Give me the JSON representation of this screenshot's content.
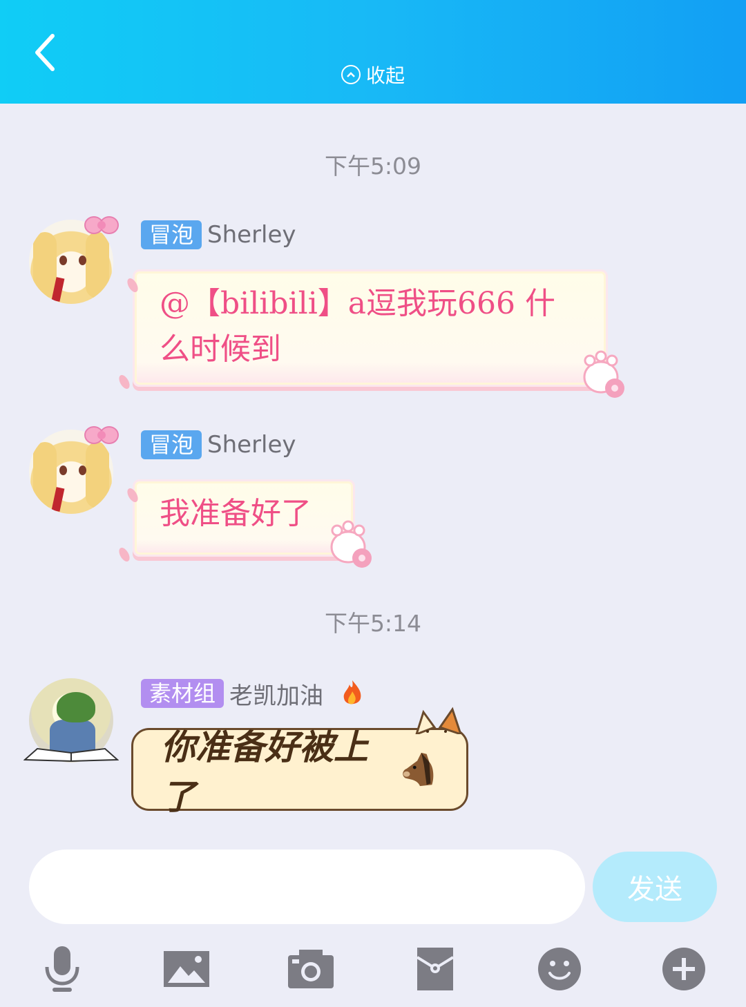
{
  "header": {
    "collapse_label": "收起",
    "back_icon": "chevron-left-icon",
    "collapse_icon": "chevron-up-circle-icon"
  },
  "messages": [
    {
      "type": "timestamp",
      "text": "下午5:09"
    },
    {
      "type": "message",
      "badge": "冒泡",
      "sender": "Sherley",
      "text_line1": "@【bilibili】a逗我玩666 什",
      "text_line2": "么时候到"
    },
    {
      "type": "message",
      "badge": "冒泡",
      "sender": "Sherley",
      "text": "我准备好了"
    },
    {
      "type": "timestamp",
      "text": "下午5:14"
    },
    {
      "type": "message",
      "badge": "素材组",
      "sender": "老凯加油",
      "sender_icon": "flame-icon",
      "text": "你准备好被上了",
      "emoji": "horse-icon"
    }
  ],
  "input": {
    "placeholder": "",
    "value": "",
    "send_label": "发送"
  },
  "toolbar": [
    "microphone-icon",
    "image-icon",
    "camera-icon",
    "red-packet-icon",
    "emoji-icon",
    "plus-icon"
  ],
  "colors": {
    "header_start": "#10cdf6",
    "header_end": "#129ff4",
    "badge_blue": "#5aa7ef",
    "badge_purple": "#b28ef0",
    "pink_text": "#ef4f86",
    "send_button": "#b4ebfc",
    "toolbar_icon": "#7c7c84"
  }
}
